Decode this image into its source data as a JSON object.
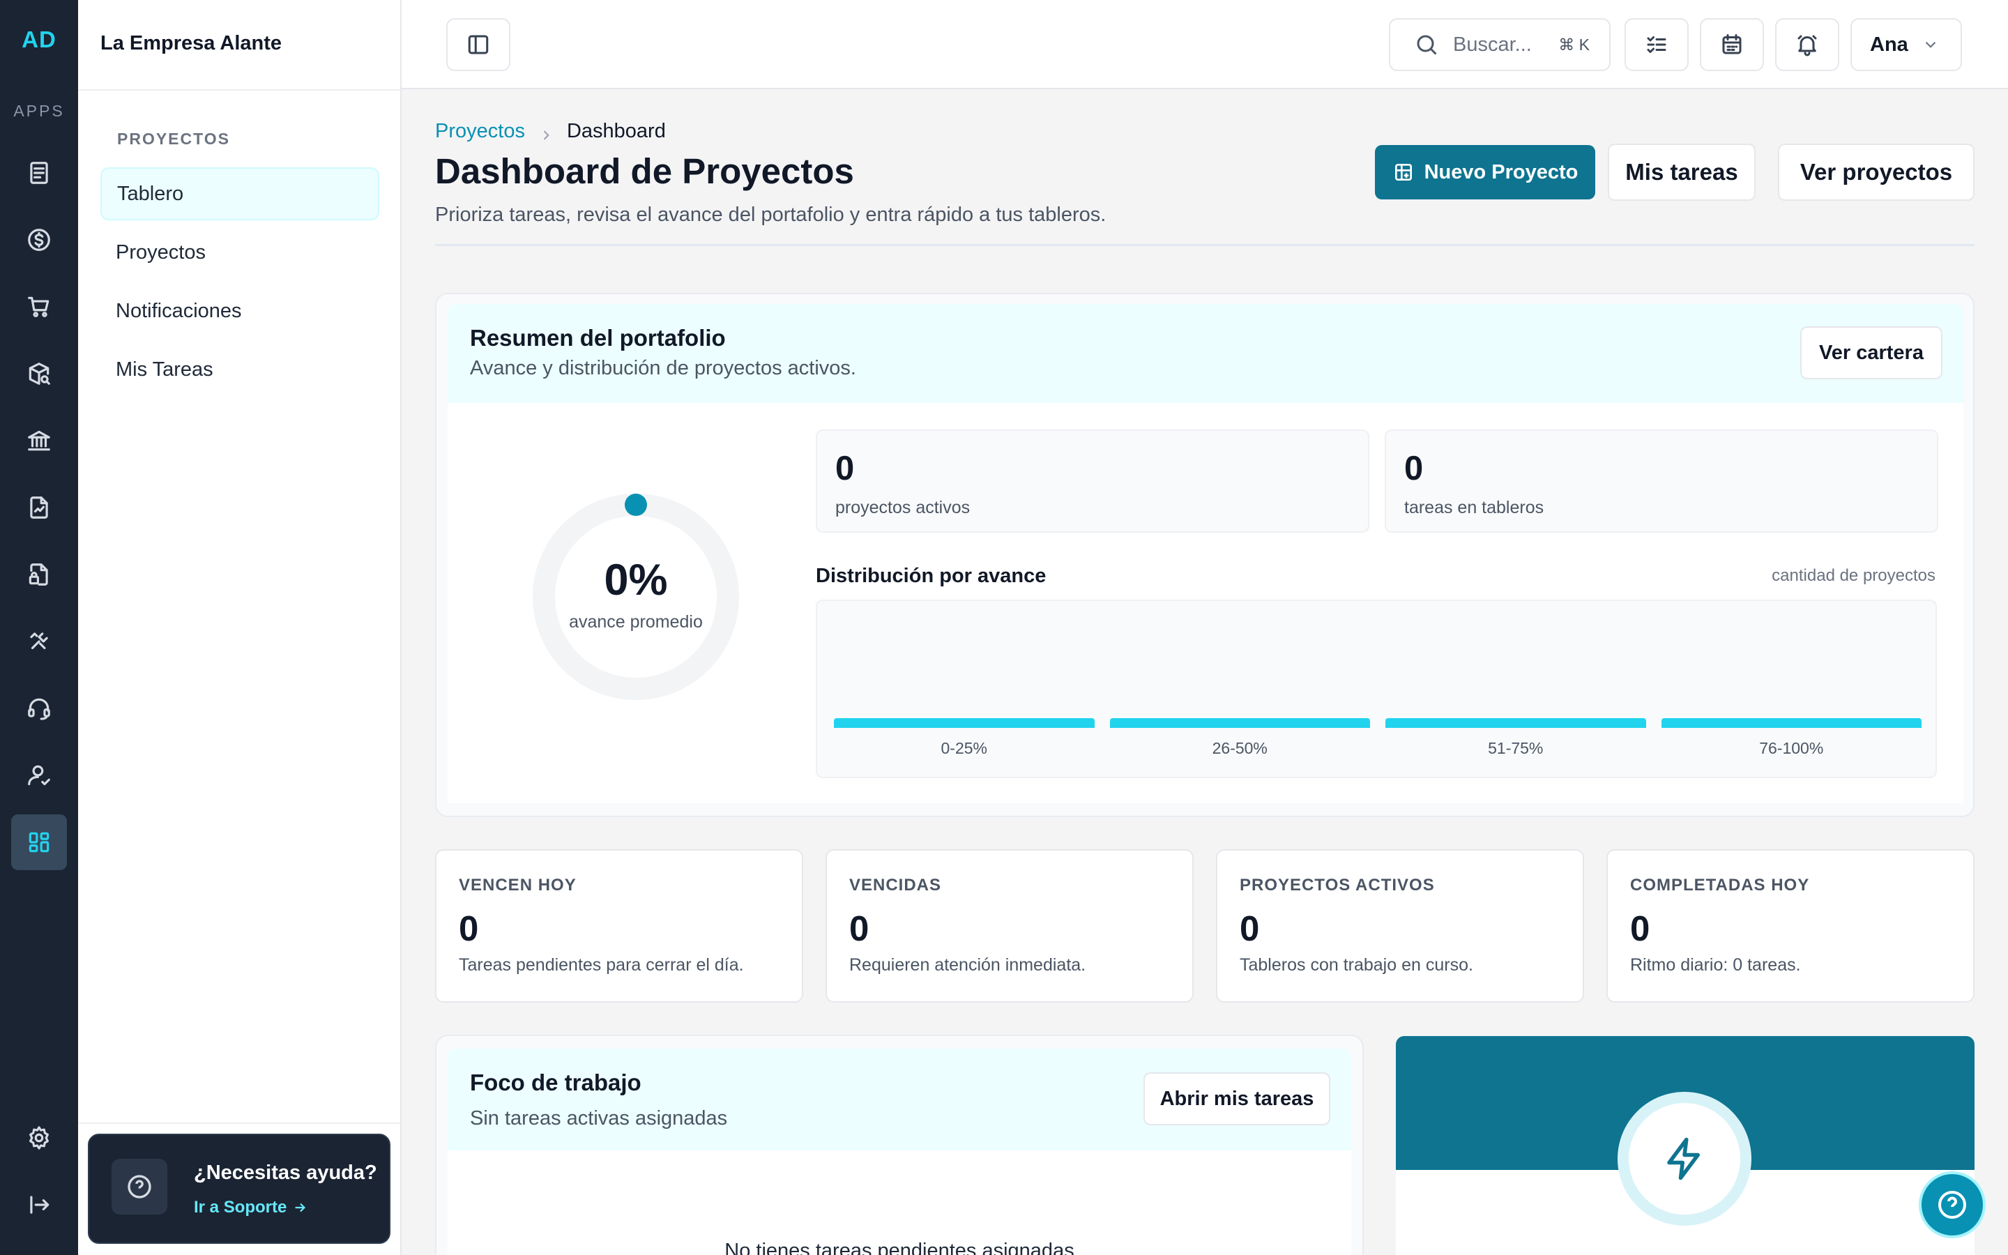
{
  "app": {
    "logo": "AD",
    "apps_label": "APPS",
    "company": "La Empresa Alante",
    "rail_icons": [
      "document-icon",
      "dollar-icon",
      "cart-icon",
      "package-search-icon",
      "bank-icon",
      "chart-file-icon",
      "file-lock-icon",
      "tools-icon",
      "headset-icon",
      "user-icon",
      "dashboard-icon",
      "settings-icon",
      "logout-icon"
    ]
  },
  "nav": {
    "section": "PROYECTOS",
    "items": [
      {
        "label": "Tablero",
        "active": true
      },
      {
        "label": "Proyectos"
      },
      {
        "label": "Notificaciones"
      },
      {
        "label": "Mis Tareas"
      }
    ]
  },
  "help": {
    "title": "¿Necesitas ayuda?",
    "link": "Ir a Soporte"
  },
  "topbar": {
    "search_placeholder": "Buscar...",
    "shortcut": "⌘ K",
    "user": "Ana"
  },
  "page": {
    "breadcrumb": [
      "Proyectos",
      "Dashboard"
    ],
    "title": "Dashboard de Proyectos",
    "subtitle": "Prioriza tareas, revisa el avance del portafolio y entra rápido a tus tableros.",
    "actions": {
      "new_project": "Nuevo Proyecto",
      "my_tasks": "Mis tareas",
      "view_projects": "Ver proyectos"
    }
  },
  "portfolio": {
    "title": "Resumen del portafolio",
    "subtitle": "Avance y distribución de proyectos activos.",
    "button": "Ver cartera",
    "avg_progress": "0%",
    "avg_progress_value": 0,
    "avg_label": "avance promedio",
    "active_projects": "0",
    "active_projects_label": "proyectos activos",
    "board_tasks": "0",
    "board_tasks_label": "tareas en tableros",
    "distribution_title": "Distribución por avance",
    "distribution_note": "cantidad de proyectos",
    "distribution": [
      {
        "label": "0-25%",
        "value": 0
      },
      {
        "label": "26-50%",
        "value": 0
      },
      {
        "label": "51-75%",
        "value": 0
      },
      {
        "label": "76-100%",
        "value": 0
      }
    ]
  },
  "kpis": [
    {
      "key": "VENCEN HOY",
      "value": "0",
      "desc": "Tareas pendientes para cerrar el día."
    },
    {
      "key": "VENCIDAS",
      "value": "0",
      "desc": "Requieren atención inmediata."
    },
    {
      "key": "PROYECTOS ACTIVOS",
      "value": "0",
      "desc": "Tableros con trabajo en curso."
    },
    {
      "key": "COMPLETADAS HOY",
      "value": "0",
      "desc": "Ritmo diario: 0 tareas."
    }
  ],
  "focus": {
    "title": "Foco de trabajo",
    "subtitle": "Sin tareas activas asignadas",
    "button": "Abrir mis tareas",
    "empty": "No tienes tareas pendientes asignadas"
  },
  "colors": {
    "accent": "#0e7490",
    "accent_light": "#22d3ee",
    "sidebar_bg": "#1b2433"
  }
}
